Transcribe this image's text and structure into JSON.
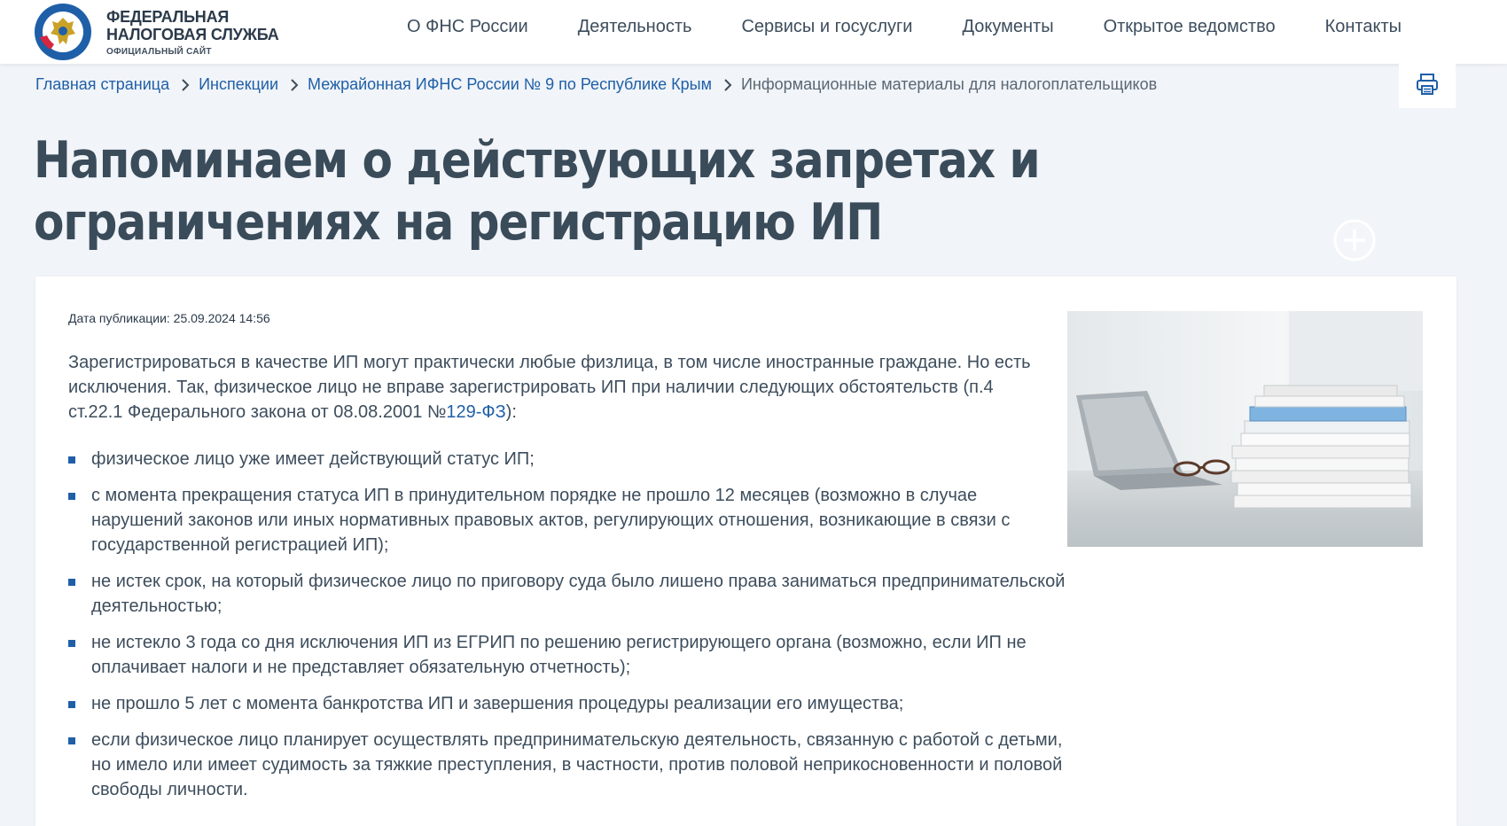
{
  "header": {
    "logo_line1": "ФЕДЕРАЛЬНАЯ",
    "logo_line2": "НАЛОГОВАЯ СЛУЖБА",
    "logo_sub": "ОФИЦИАЛЬНЫЙ САЙТ",
    "nav": [
      "О ФНС России",
      "Деятельность",
      "Сервисы и госуслуги",
      "Документы",
      "Открытое ведомство",
      "Контакты"
    ]
  },
  "breadcrumb": {
    "items": [
      "Главная страница",
      "Инспекции",
      "Межрайонная ИФНС России № 9 по Республике Крым"
    ],
    "current": "Информационные материалы для налогоплательщиков"
  },
  "article": {
    "title": "Напоминаем о действующих запретах и ограничениях на регистрацию ИП",
    "pub_date": "Дата публикации: 25.09.2024 14:56",
    "intro_before_link": "Зарегистрироваться в качестве ИП могут практически любые физлица, в том числе иностранные граждане. Но есть исключения. Так, физическое лицо не вправе зарегистрировать ИП при наличии следующих обстоятельств (п.4 ст.22.1 Федерального закона от 08.08.2001 №",
    "intro_link": "129-ФЗ",
    "intro_after_link": "):",
    "list": [
      "физическое лицо уже имеет действующий статус ИП;",
      "с момента прекращения статуса ИП в принудительном порядке не прошло 12 месяцев (возможно в случае нарушений законов или иных нормативных правовых актов, регулирующих отношения, возникающие в связи с государственной регистрацией ИП);",
      "не истек срок, на который физическое лицо по приговору суда было лишено права заниматься предпринимательской деятельностью;",
      "не истекло 3 года со дня исключения ИП из ЕГРИП по решению регистрирующего органа (возможно, если ИП не оплачивает налоги и не представляет обязательную отчетность);",
      "не прошло 5 лет с момента банкротства ИП и завершения процедуры реализации его имущества;",
      "если физическое лицо планирует осуществлять предпринимательскую деятельность, связанную с работой с детьми, но имело или имеет судимость за тяжкие преступления, в частности, против половой неприкосновенности и половой свободы личности."
    ]
  },
  "colors": {
    "link": "#1f5fa8",
    "text": "#3d4d5c",
    "background": "#f1f4f8"
  },
  "icons": [
    "fns-emblem-icon",
    "chevron-right-icon",
    "print-icon",
    "zoom-plus-icon"
  ]
}
